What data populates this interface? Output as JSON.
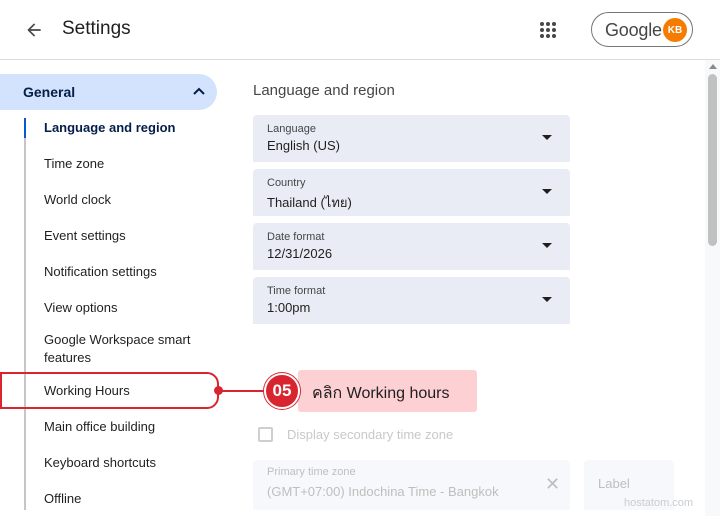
{
  "header": {
    "title": "Settings",
    "back_icon": "arrow-back-icon",
    "apps_icon": "apps-grid-icon",
    "account": {
      "brand": "Google",
      "avatar_initials": "KB",
      "avatar_color": "#f57c00"
    }
  },
  "sidebar": {
    "section": {
      "label": "General",
      "expanded": true
    },
    "items": [
      {
        "label": "Language and region",
        "active": true
      },
      {
        "label": "Time zone"
      },
      {
        "label": "World clock"
      },
      {
        "label": "Event settings"
      },
      {
        "label": "Notification settings"
      },
      {
        "label": "View options"
      },
      {
        "label": "Google Workspace smart features"
      },
      {
        "label": "Working Hours"
      },
      {
        "label": "Main office building"
      },
      {
        "label": "Keyboard shortcuts"
      },
      {
        "label": "Offline"
      }
    ]
  },
  "main": {
    "section_title": "Language and region",
    "fields": [
      {
        "label": "Language",
        "value": "English (US)"
      },
      {
        "label": "Country",
        "value": "Thailand (ไทย)"
      },
      {
        "label": "Date format",
        "value": "12/31/2026"
      },
      {
        "label": "Time format",
        "value": "1:00pm"
      }
    ],
    "secondary_tz": {
      "checkbox_label": "Display secondary time zone",
      "primary_label": "Primary time zone",
      "primary_value": "(GMT+07:00) Indochina Time - Bangkok",
      "clear_glyph": "✕",
      "label_placeholder": "Label"
    }
  },
  "annotation": {
    "step": "05",
    "text": "คลิก Working hours",
    "color": "#d9252f",
    "fill": "#fdd0d3"
  },
  "watermark": "hostatom.com"
}
